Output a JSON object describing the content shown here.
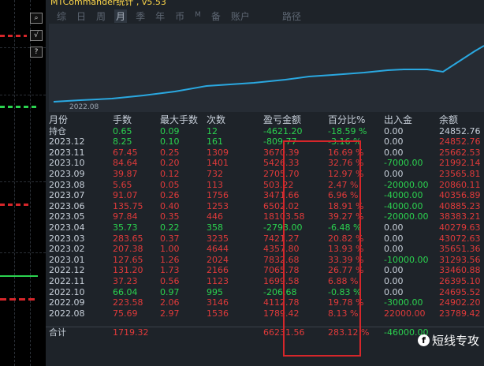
{
  "window": {
    "title": "MTCommander统计 , v5.53"
  },
  "tabs": [
    "综",
    "日",
    "周",
    "月",
    "季",
    "年",
    "币",
    "M",
    "备",
    "账户"
  ],
  "selected_tab": "月",
  "path_label": "路径",
  "chart_xtick": "2022.08",
  "columns": [
    "月份",
    "手数",
    "最大手数",
    "次数",
    "盈亏金额",
    "百分比%",
    "出入金",
    "余额"
  ],
  "holding": {
    "label": "持仓",
    "cells": [
      "0.65",
      "0.09",
      "12",
      "-4621.20",
      "-18.59 %",
      "0.00",
      "24852.76"
    ]
  },
  "rows": [
    {
      "month": "2023.12",
      "cells": [
        "8.25",
        "0.10",
        "161",
        "-809.77",
        "-3.16 %",
        "0.00",
        "24852.76"
      ],
      "pnl": "neg"
    },
    {
      "month": "2023.11",
      "cells": [
        "67.45",
        "0.25",
        "1309",
        "3670.39",
        "16.69 %",
        "0.00",
        "25662.53"
      ],
      "pnl": "pos"
    },
    {
      "month": "2023.10",
      "cells": [
        "84.64",
        "0.20",
        "1401",
        "5426.33",
        "32.76 %",
        "-7000.00",
        "21992.14"
      ],
      "pnl": "pos"
    },
    {
      "month": "2023.09",
      "cells": [
        "39.87",
        "0.12",
        "732",
        "2705.70",
        "12.97 %",
        "0.00",
        "23565.81"
      ],
      "pnl": "pos"
    },
    {
      "month": "2023.08",
      "cells": [
        "5.65",
        "0.05",
        "113",
        "503.22",
        "2.47 %",
        "-20000.00",
        "20860.11"
      ],
      "pnl": "pos"
    },
    {
      "month": "2023.07",
      "cells": [
        "91.07",
        "0.26",
        "1756",
        "3471.66",
        "6.96 %",
        "-4000.00",
        "40356.89"
      ],
      "pnl": "pos"
    },
    {
      "month": "2023.06",
      "cells": [
        "135.75",
        "0.40",
        "1253",
        "6502.02",
        "18.91 %",
        "-4000.00",
        "40885.23"
      ],
      "pnl": "pos"
    },
    {
      "month": "2023.05",
      "cells": [
        "97.84",
        "0.35",
        "446",
        "18103.58",
        "39.27 %",
        "-20000.00",
        "38383.21"
      ],
      "pnl": "pos"
    },
    {
      "month": "2023.04",
      "cells": [
        "35.73",
        "0.22",
        "358",
        "-2793.00",
        "-6.48 %",
        "0.00",
        "40279.63"
      ],
      "pnl": "neg"
    },
    {
      "month": "2023.03",
      "cells": [
        "283.65",
        "0.37",
        "3235",
        "7421.27",
        "20.82 %",
        "0.00",
        "43072.63"
      ],
      "pnl": "pos"
    },
    {
      "month": "2023.02",
      "cells": [
        "207.38",
        "1.00",
        "4644",
        "4357.80",
        "13.93 %",
        "0.00",
        "35651.36"
      ],
      "pnl": "pos"
    },
    {
      "month": "2023.01",
      "cells": [
        "127.65",
        "1.26",
        "2024",
        "7832.68",
        "33.39 %",
        "-10000.00",
        "31293.56"
      ],
      "pnl": "pos"
    },
    {
      "month": "2022.12",
      "cells": [
        "131.20",
        "1.73",
        "2166",
        "7065.78",
        "26.77 %",
        "0.00",
        "33460.88"
      ],
      "pnl": "pos"
    },
    {
      "month": "2022.11",
      "cells": [
        "37.23",
        "0.56",
        "1123",
        "1699.58",
        "6.88 %",
        "0.00",
        "26395.10"
      ],
      "pnl": "pos"
    },
    {
      "month": "2022.10",
      "cells": [
        "66.04",
        "0.97",
        "995",
        "-206.68",
        "-0.83 %",
        "0.00",
        "24695.52"
      ],
      "pnl": "neg"
    },
    {
      "month": "2022.09",
      "cells": [
        "223.58",
        "2.06",
        "3146",
        "4112.78",
        "19.78 %",
        "-3000.00",
        "24902.20"
      ],
      "pnl": "pos"
    },
    {
      "month": "2022.08",
      "cells": [
        "75.69",
        "2.97",
        "1536",
        "1789.42",
        "8.13 %",
        "22000.00",
        "23789.42"
      ],
      "pnl": "pos"
    }
  ],
  "total": {
    "label": "合计",
    "cells": [
      "1719.32",
      "",
      "",
      "66231.56",
      "283.12 %",
      "-46000.00",
      ""
    ]
  },
  "watermark": "短线专攻",
  "colors": {
    "profit": "#e03a3a",
    "loss": "#2bd24f",
    "curve": "#2aa8e0",
    "highlight": "#d6262a"
  },
  "left_toolbar_icons": [
    "magnifier-icon",
    "checkmark-icon",
    "help-icon"
  ]
}
